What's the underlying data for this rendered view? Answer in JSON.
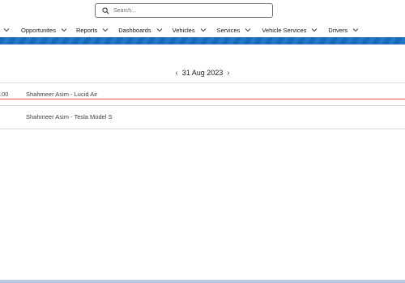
{
  "search": {
    "placeholder": "Search..."
  },
  "nav": {
    "items": [
      {
        "label": ""
      },
      {
        "label": "Opportunites"
      },
      {
        "label": "Reports"
      },
      {
        "label": "Dashboards"
      },
      {
        "label": "Vehicles"
      },
      {
        "label": "Services"
      },
      {
        "label": "Vehicle Services"
      },
      {
        "label": "Drivers"
      }
    ]
  },
  "calendar": {
    "date": "31 Aug 2023",
    "prev_icon": "‹",
    "next_icon": "›",
    "rows": [
      {
        "time": ":00",
        "text": "Shahmeer Asim - Lucid Air"
      },
      {
        "time": "",
        "text": "Shahmeer Asim - Tesla Model S"
      }
    ]
  },
  "colors": {
    "brand_strip": "#1b6ab8",
    "now_line": "#e05a5a"
  }
}
